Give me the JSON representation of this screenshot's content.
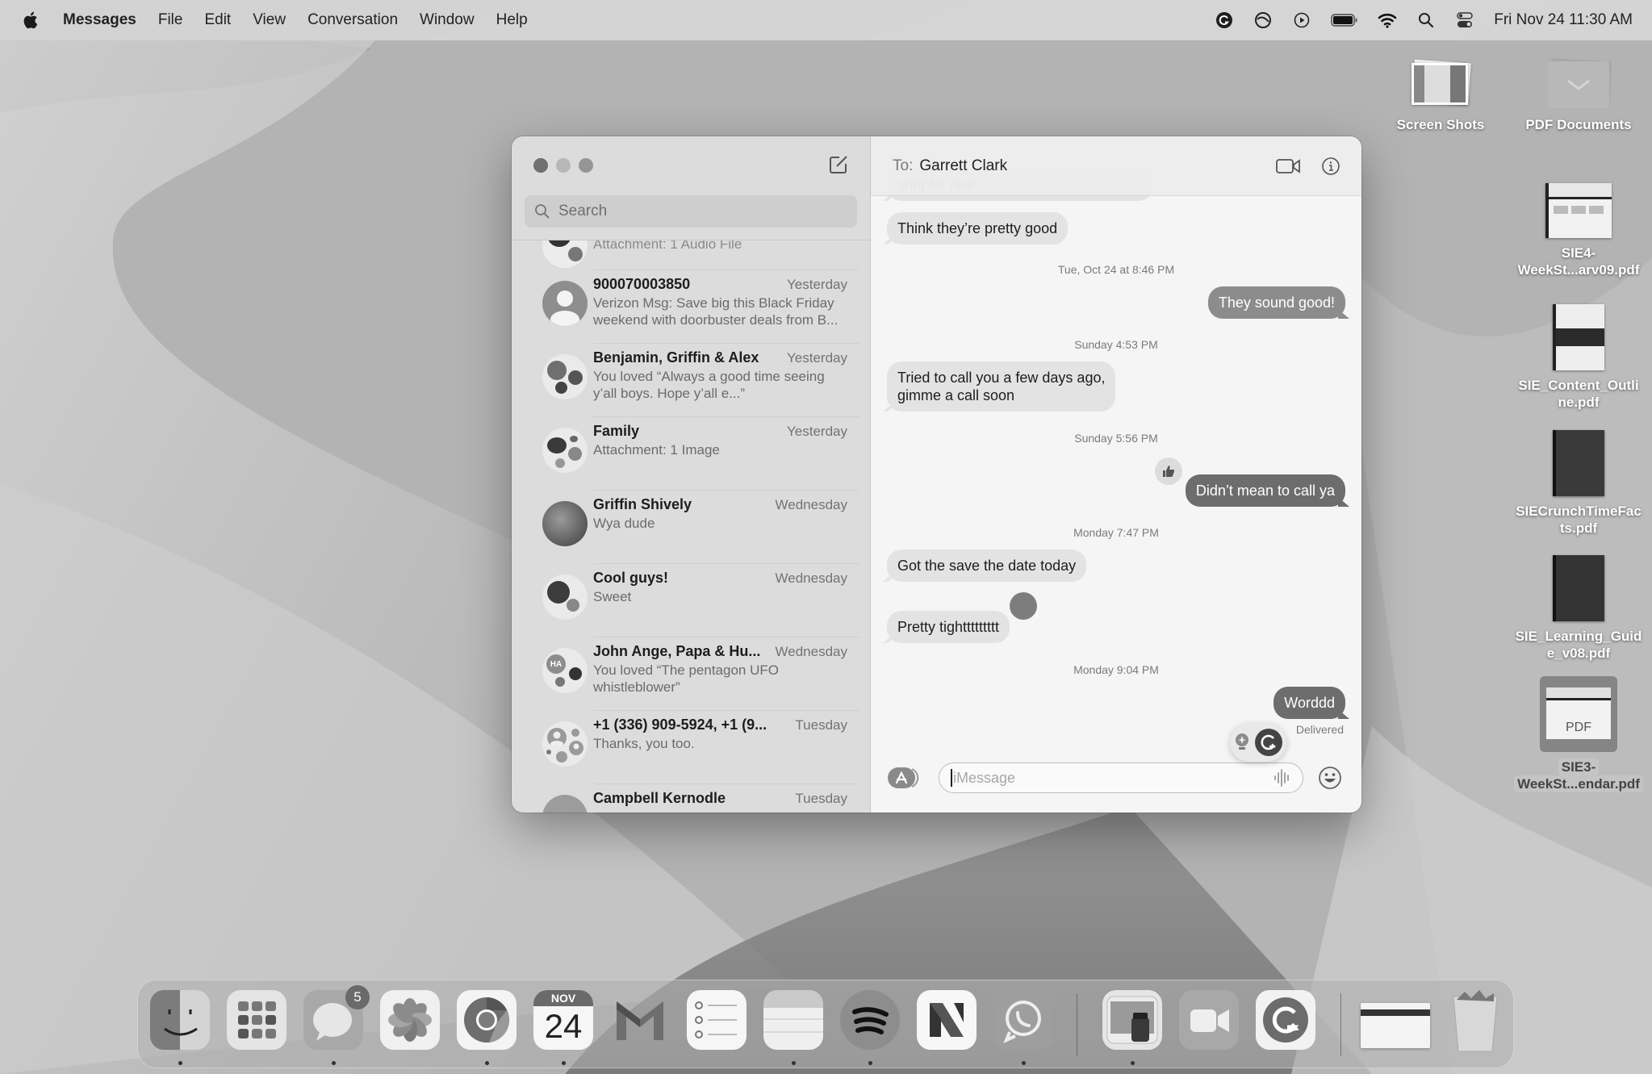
{
  "menubar": {
    "app_name": "Messages",
    "items": [
      "File",
      "Edit",
      "View",
      "Conversation",
      "Window",
      "Help"
    ],
    "status_icons": [
      "grammarly-icon",
      "vpn-icon",
      "media-play-icon",
      "battery-icon",
      "wifi-icon",
      "spotlight-search-icon",
      "control-center-icon"
    ],
    "clock": "Fri Nov 24  11:30 AM"
  },
  "desktop": {
    "icons": [
      {
        "label": "Screen Shots",
        "type": "stack"
      },
      {
        "label": "PDF Documents",
        "type": "stack"
      },
      {
        "label": "SIE4-\nWeekSt...arv09.pdf",
        "label_line1": "SIE4-",
        "label_line2": "WeekSt...arv09.pdf",
        "type": "pdf"
      },
      {
        "label_line1": "SIE_Content_Outli",
        "label_line2": "ne.pdf",
        "type": "pdf"
      },
      {
        "label_line1": "SIECrunchTimeFac",
        "label_line2": "ts.pdf",
        "type": "pdf"
      },
      {
        "label_line1": "SIE_Learning_Guid",
        "label_line2": "e_v08.pdf",
        "type": "pdf"
      },
      {
        "label_line1": "SIE3-",
        "label_line2": "WeekSt...endar.pdf",
        "type": "pdf",
        "selected": true,
        "thumb_text": "PDF"
      }
    ]
  },
  "sidebar": {
    "search_placeholder": "Search",
    "partial_preview": "Attachment: 1 Audio File",
    "conversations": [
      {
        "name": "900070003850",
        "time": "Yesterday",
        "preview": "Verizon Msg: Save big this Black Friday weekend with doorbuster deals from B...",
        "avatar": "person-placeholder"
      },
      {
        "name": "Benjamin, Griffin & Alex",
        "time": "Yesterday",
        "preview": "You loved “Always a good time seeing y’all boys. Hope y’all e...”",
        "avatar": "group"
      },
      {
        "name": "Family",
        "time": "Yesterday",
        "preview": "Attachment: 1 Image",
        "avatar": "group"
      },
      {
        "name": "Griffin Shively",
        "time": "Wednesday",
        "preview": "Wya dude",
        "avatar": "photo"
      },
      {
        "name": "Cool guys!",
        "time": "Wednesday",
        "preview": "Sweet",
        "avatar": "group"
      },
      {
        "name": "John Ange, Papa & Hu...",
        "time": "Wednesday",
        "preview": "You loved “The pentagon UFO whistleblower”",
        "avatar": "group",
        "initials": "HA"
      },
      {
        "name": "+1 (336) 909-5924, +1 (9...",
        "time": "Tuesday",
        "preview": "Thanks, you too.",
        "avatar": "group-placeholder"
      },
      {
        "name": "Campbell Kernodle",
        "time": "Tuesday",
        "preview": "",
        "avatar": "photo"
      }
    ]
  },
  "chat": {
    "to_label": "To:",
    "recipient": "Garrett Clark",
    "messages": [
      {
        "kind": "in",
        "text": "shot for real",
        "partial": true
      },
      {
        "kind": "in",
        "text": "Think they’re pretty good"
      },
      {
        "kind": "stamp",
        "text": "Tue, Oct 24 at 8:46 PM"
      },
      {
        "kind": "out",
        "text": "They sound good!"
      },
      {
        "kind": "stamp",
        "text": "Sunday 4:53 PM"
      },
      {
        "kind": "in",
        "text": "Tried to call you a few days ago,\ngimme a call soon",
        "line1": "Tried to call you a few days ago,",
        "line2": "gimme a call soon"
      },
      {
        "kind": "stamp",
        "text": "Sunday 5:56 PM"
      },
      {
        "kind": "out",
        "text": "Didn’t mean to call ya",
        "tapback": "thumbs-up"
      },
      {
        "kind": "stamp",
        "text": "Monday 7:47 PM"
      },
      {
        "kind": "in",
        "text": "Got the save the date today"
      },
      {
        "kind": "in",
        "text": "Pretty tighttttttttt",
        "tapback": "emphasis"
      },
      {
        "kind": "stamp",
        "text": "Monday 9:04 PM"
      },
      {
        "kind": "out",
        "text": "Worddd"
      }
    ],
    "delivered": "Delivered",
    "input_placeholder": "iMessage"
  },
  "dock": {
    "apps": [
      {
        "name": "Finder",
        "running": true
      },
      {
        "name": "Launchpad",
        "running": false
      },
      {
        "name": "Messages",
        "running": true,
        "badge": "5"
      },
      {
        "name": "Photos",
        "running": false
      },
      {
        "name": "Chrome",
        "running": true
      },
      {
        "name": "Calendar",
        "running": true,
        "month": "NOV",
        "day": "24"
      },
      {
        "name": "Gmail",
        "running": false
      },
      {
        "name": "Reminders",
        "running": false
      },
      {
        "name": "Notes",
        "running": true
      },
      {
        "name": "Spotify",
        "running": true
      },
      {
        "name": "News",
        "running": false
      },
      {
        "name": "WhatsApp",
        "running": true
      },
      {
        "name": "Preview",
        "running": true
      },
      {
        "name": "FaceTime",
        "running": false
      },
      {
        "name": "Grammarly",
        "running": false
      },
      {
        "name": "Recent Document",
        "running": false
      },
      {
        "name": "Trash",
        "running": false
      }
    ]
  }
}
